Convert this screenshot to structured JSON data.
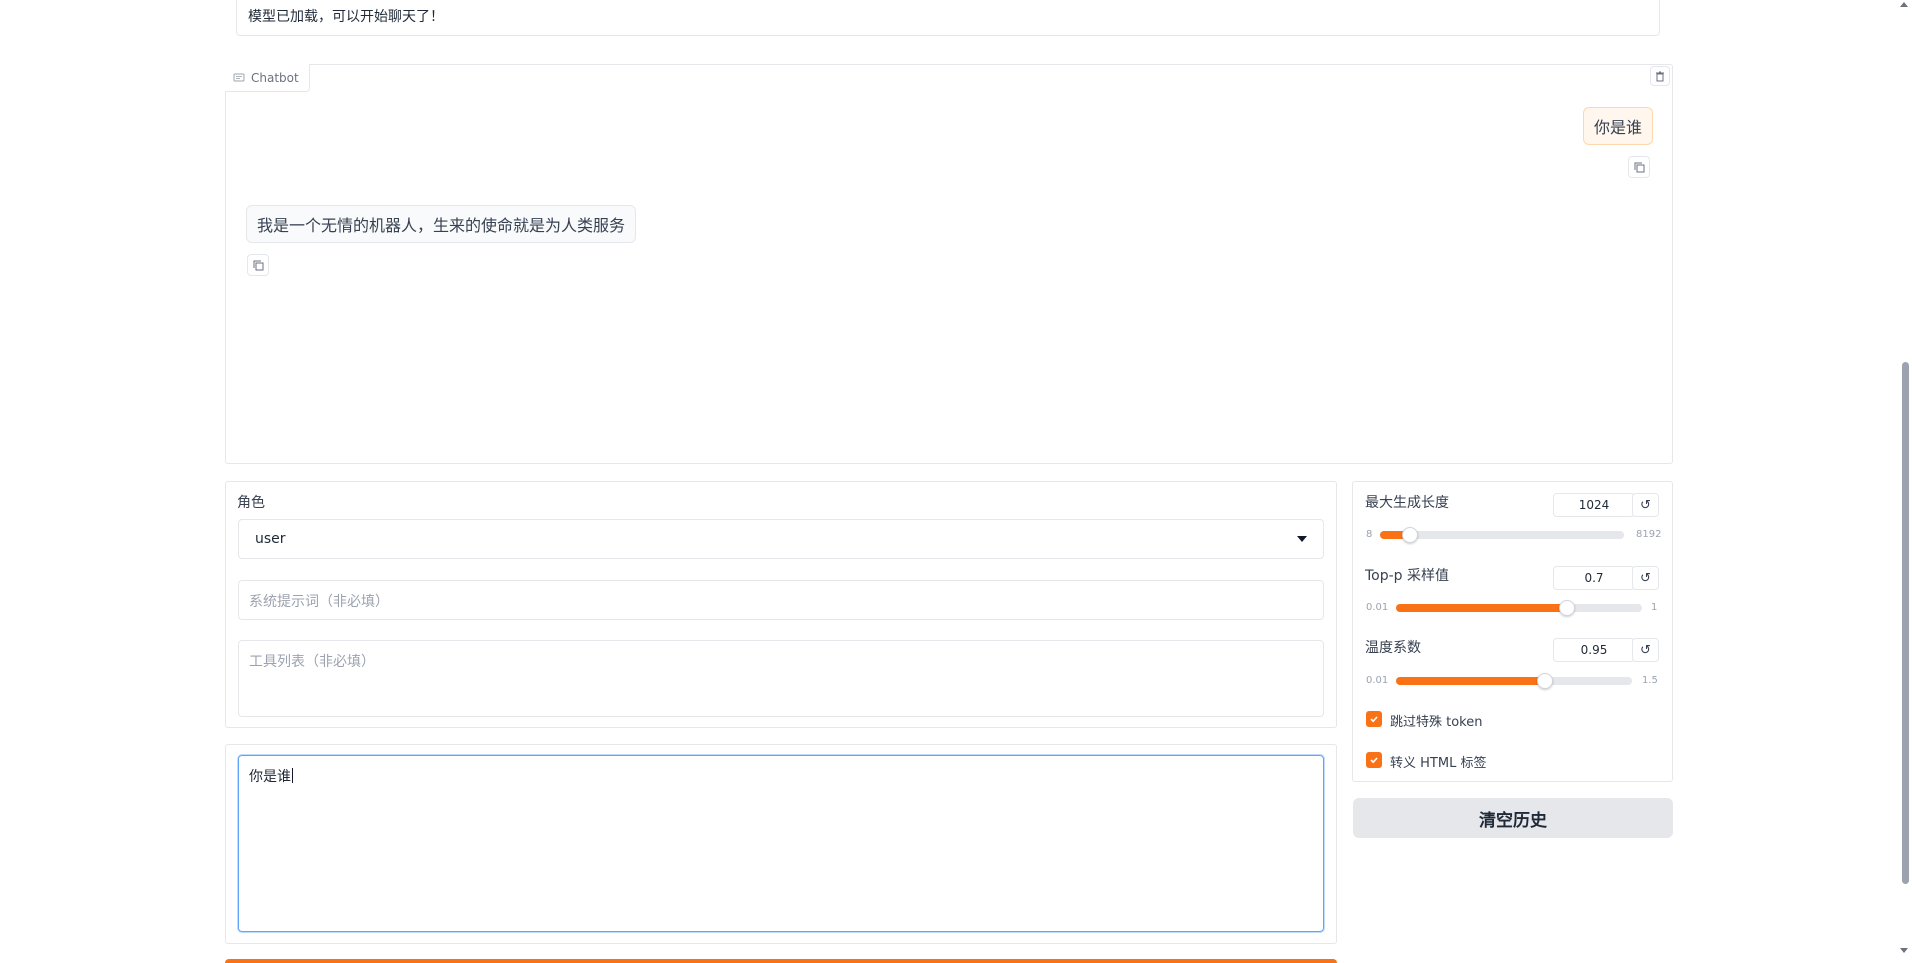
{
  "status": {
    "text": "模型已加载，可以开始聊天了！"
  },
  "chatbot": {
    "label": "Chatbot",
    "messages": [
      {
        "role": "user",
        "text": "你是谁"
      },
      {
        "role": "bot",
        "text": "我是一个无情的机器人，生来的使命就是为人类服务"
      }
    ]
  },
  "config": {
    "role_label": "角色",
    "role_value": "user",
    "system_placeholder": "系统提示词（非必填）",
    "tools_placeholder": "工具列表（非必填）"
  },
  "query": {
    "value": "你是谁"
  },
  "settings": {
    "sliders": [
      {
        "label": "最大生成长度",
        "value": "1024",
        "min": "8",
        "max": "8192",
        "fraction": 0.124
      },
      {
        "label": "Top-p 采样值",
        "value": "0.7",
        "min": "0.01",
        "max": "1",
        "fraction": 0.697
      },
      {
        "label": "温度系数",
        "value": "0.95",
        "min": "0.01",
        "max": "1.5",
        "fraction": 0.631
      }
    ],
    "checkboxes": [
      {
        "label": "跳过特殊 token",
        "checked": true
      },
      {
        "label": "转义 HTML 标签",
        "checked": true
      }
    ],
    "clear_button": "清空历史"
  },
  "colors": {
    "accent": "#f97316",
    "button_bg": "#e5e7eb"
  }
}
